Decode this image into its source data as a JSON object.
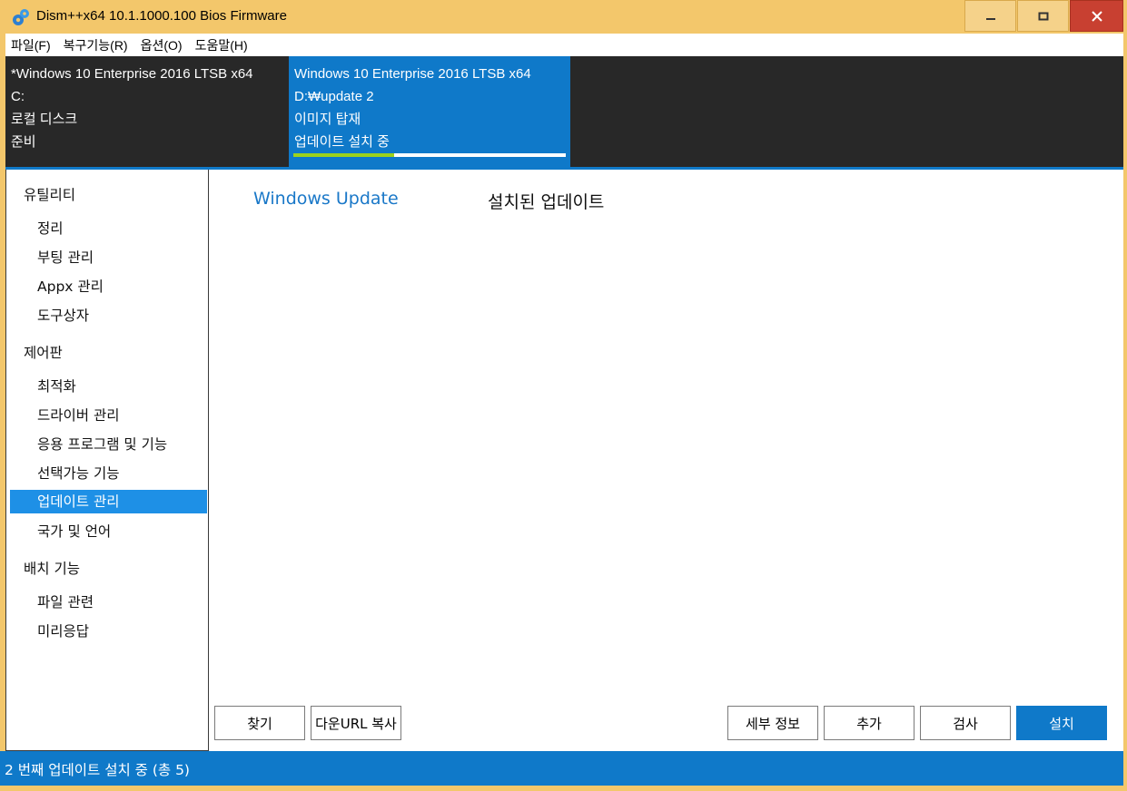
{
  "window": {
    "title": "Dism++x64 10.1.1000.100 Bios Firmware",
    "accent": "#0f79c9",
    "frame_color": "#f3c76b"
  },
  "menu": [
    {
      "label": "파일(F)"
    },
    {
      "label": "복구기능(R)"
    },
    {
      "label": "옵션(O)"
    },
    {
      "label": "도움말(H)"
    }
  ],
  "images": [
    {
      "name": "*Windows 10 Enterprise 2016 LTSB x64",
      "path": "C:",
      "type": "로컬 디스크",
      "state": "준비"
    },
    {
      "name": "Windows 10 Enterprise 2016 LTSB x64",
      "path": "D:₩update 2",
      "type": "이미지 탑재",
      "state": "업데이트 설치 중",
      "progress": 0.37
    }
  ],
  "sidebar": {
    "groups": [
      {
        "label": "유틸리티",
        "items": [
          {
            "label": "정리"
          },
          {
            "label": "부팅 관리"
          },
          {
            "label": "Appx 관리"
          },
          {
            "label": "도구상자"
          }
        ]
      },
      {
        "label": "제어판",
        "items": [
          {
            "label": "최적화"
          },
          {
            "label": "드라이버 관리"
          },
          {
            "label": "응용 프로그램 및 기능"
          },
          {
            "label": "선택가능 기능"
          },
          {
            "label": "업데이트 관리"
          },
          {
            "label": "국가 및 언어"
          }
        ]
      },
      {
        "label": "배치 기능",
        "items": [
          {
            "label": "파일 관련"
          },
          {
            "label": "미리응답"
          }
        ]
      }
    ],
    "active": "업데이트 관리"
  },
  "content": {
    "tabs": [
      {
        "label": "Windows Update"
      },
      {
        "label": "설치된 업데이트"
      }
    ],
    "left_buttons": [
      {
        "label": "찾기"
      },
      {
        "label": "다운URL 복사"
      }
    ],
    "right_buttons": [
      {
        "label": "세부 정보"
      },
      {
        "label": "추가"
      },
      {
        "label": "검사"
      },
      {
        "label": "설치"
      }
    ]
  },
  "status": {
    "text": "2 번째 업데이트 설치 중 (총 5)"
  }
}
